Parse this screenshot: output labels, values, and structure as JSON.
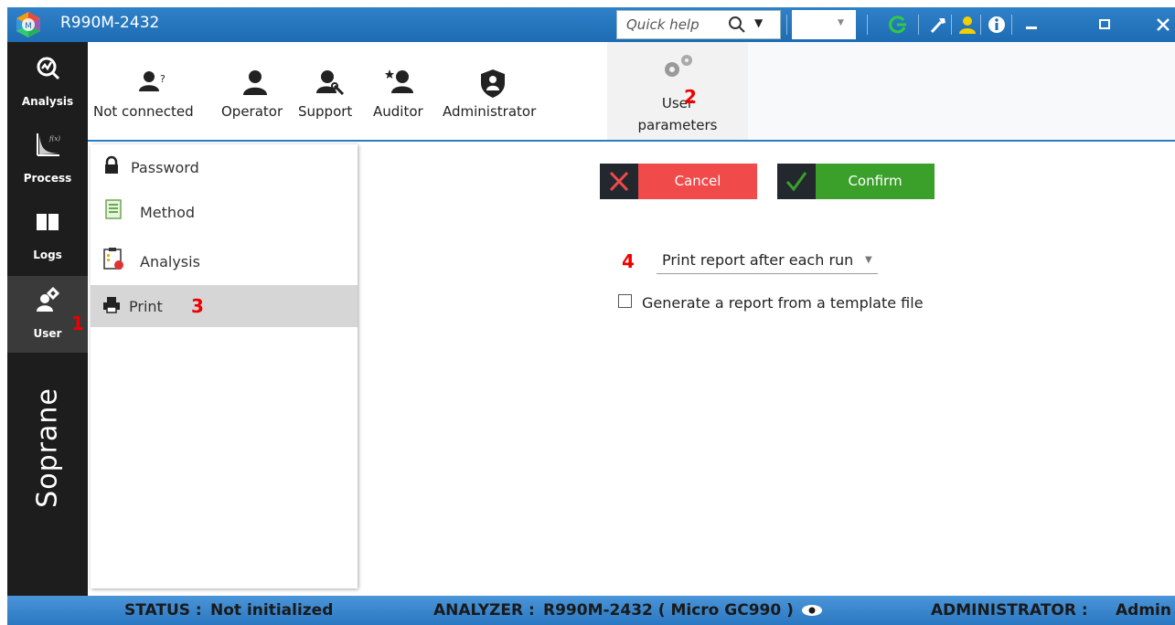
{
  "titlebar": {
    "app_title": "R990M-2432",
    "quick_help_placeholder": "Quick help",
    "combo_value": ""
  },
  "leftnav": {
    "items": [
      {
        "label": "Analysis",
        "icon": "analysis-icon"
      },
      {
        "label": "Process",
        "icon": "function-curve-icon"
      },
      {
        "label": "Logs",
        "icon": "book-icon"
      },
      {
        "label": "User",
        "icon": "users-icon",
        "active": true
      }
    ],
    "brand": "Soprane"
  },
  "ribbon": {
    "items": [
      {
        "label": "Not connected",
        "icon": "user-question-icon"
      },
      {
        "label": "Operator",
        "icon": "user-icon"
      },
      {
        "label": "Support",
        "icon": "user-wrench-icon"
      },
      {
        "label": "Auditor",
        "icon": "user-star-icon"
      },
      {
        "label": "Administrator",
        "icon": "shield-user-icon"
      }
    ],
    "user_parameters": {
      "line1": "User",
      "line2": "parameters",
      "icon": "gears-icon"
    }
  },
  "sidelist": {
    "items": [
      {
        "label": "Password",
        "icon": "lock-icon"
      },
      {
        "label": "Method",
        "icon": "method-doc-icon"
      },
      {
        "label": "Analysis",
        "icon": "clipboard-chart-icon"
      },
      {
        "label": "Print",
        "icon": "printer-icon",
        "active": true
      }
    ]
  },
  "actions": {
    "cancel": "Cancel",
    "confirm": "Confirm"
  },
  "print_settings": {
    "report_mode": "Print report after each run",
    "template_checkbox_label": "Generate a report from a template file",
    "template_checked": false
  },
  "markers": [
    "1",
    "2",
    "3",
    "4"
  ],
  "statusbar": {
    "status_label": "STATUS :",
    "status_value": "Not initialized",
    "analyzer_label": "ANALYZER :",
    "analyzer_value": "R990M-2432 ( Micro GC990 )",
    "admin_label": "ADMINISTRATOR :",
    "admin_value": "Admin"
  },
  "colors": {
    "titlebar": "#1e6cb3",
    "leftnav": "#1d1d1d",
    "cancel": "#f04a4a",
    "confirm": "#3aa02a",
    "marker": "#ee0000",
    "statusbar": "#2b78c2"
  }
}
